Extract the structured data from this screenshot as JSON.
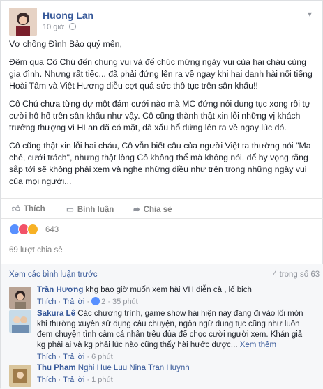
{
  "post": {
    "author": "Huong Lan",
    "time": "10 giờ",
    "paragraphs": [
      "Vợ chồng Đình Bảo quý mến,",
      "Đêm qua Cô Chú đến chung vui và để chúc mừng ngày vui của hai cháu cùng gia đình. Nhưng rất tiếc... đã phải đứng lên ra về ngay khi hai danh hài nổi tiếng Hoài Tâm và Việt Hương diễu cợt quá sức thô tục trên sân khấu!!",
      "Cô Chú chưa từng dự một đám cưới nào mà MC đứng nói dung tục xong rồi tự cười hô hố trên sân khấu như vậy. Cô cũng thành thật xin lỗi những vị khách trưởng thượng vì HLan đã có mặt, đã xấu hổ đứng lên ra về ngay lúc đó.",
      "Cô cũng thật xin lỗi hai cháu, Cô vẫn biết câu của người Việt ta thường nói \"Ma chê, cưới trách\", nhưng thật lòng Cô không thể mà không nói, để hy vọng rằng sắp tới sẽ không phải xem và nghe những điều như trên trong những ngày vui của mọi người..."
    ]
  },
  "actions": {
    "like": "Thích",
    "comment": "Bình luận",
    "share": "Chia sẻ"
  },
  "reactions": {
    "count": "643",
    "colors": [
      "#5890ff",
      "#f25268",
      "#f7b125"
    ]
  },
  "shares": "69 lượt chia sẻ",
  "comments_header": {
    "more": "Xem các bình luận trước",
    "count": "4 trong số 63"
  },
  "comments": [
    {
      "name": "Trần Hương",
      "text": "khg bao giờ muốn xem hài VH diễn cả , lố bịch",
      "like": "Thích",
      "reply": "Trả lời",
      "likes": "2",
      "time": "35 phút"
    },
    {
      "name": "Sakura Lê",
      "text": "Các chương trình, game show hài hiện nay đang đi vào lối mòn khi thường xuyên sử dụng câu chuyện, ngôn ngữ dung tục cũng như luôn đem chuyện tình cảm cá nhân trêu đùa để chọc cười người xem. Khán giả kg phải ai và kg phải lúc nào cũng thấy hài hước được...",
      "see_more": "Xem thêm",
      "like": "Thích",
      "reply": "Trả lời",
      "time": "6 phút"
    },
    {
      "name": "Thu Pham",
      "text": "Nghi Hue Luu Nina Tran Huynh",
      "like": "Thích",
      "reply": "Trả lời",
      "time": "1 phút"
    }
  ]
}
